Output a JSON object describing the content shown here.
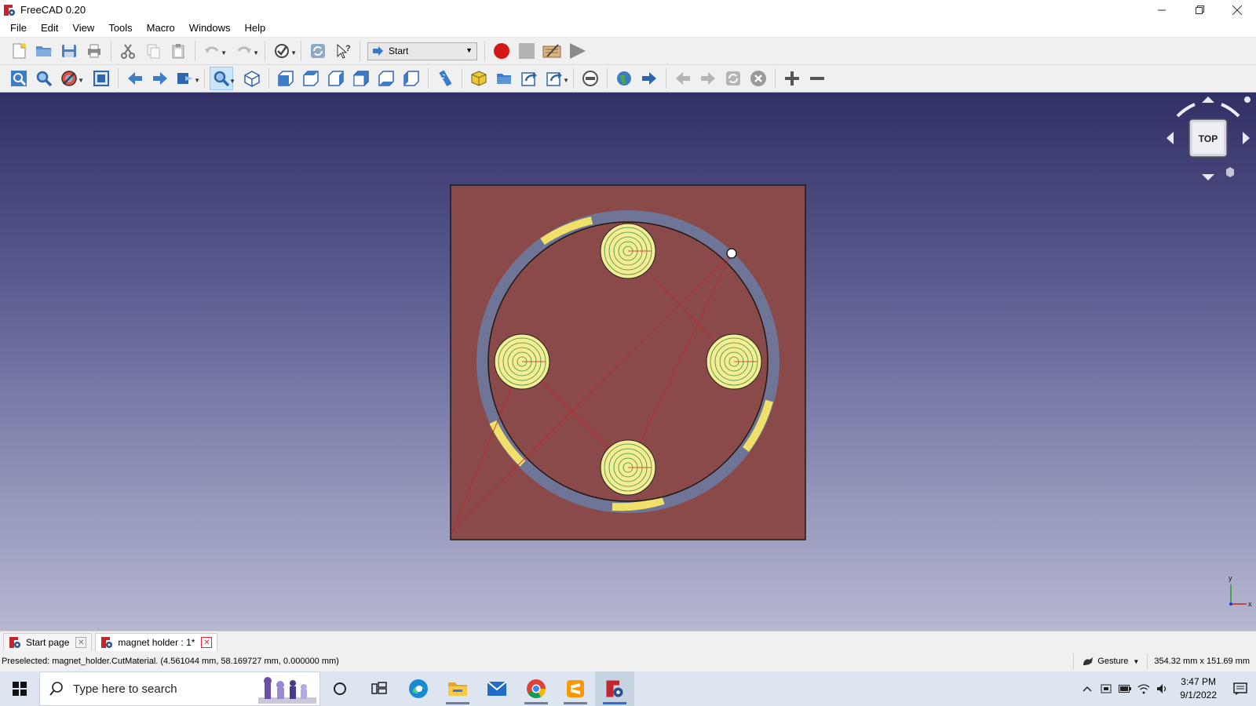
{
  "window": {
    "title": "FreeCAD 0.20"
  },
  "menu": [
    "File",
    "Edit",
    "View",
    "Tools",
    "Macro",
    "Windows",
    "Help"
  ],
  "toolbar1": {
    "workbench": "Start",
    "icons": [
      "new-file-icon",
      "open-folder-icon",
      "save-icon",
      "print-icon",
      "cut-icon",
      "copy-icon",
      "paste-icon",
      "undo-icon",
      "redo-icon",
      "refresh-icon",
      "whats-this-icon",
      "workbench-icon",
      "record-macro-icon",
      "stop-macro-icon",
      "edit-macro-icon",
      "run-macro-icon"
    ]
  },
  "toolbar2": {
    "icons": [
      "fit-all-icon",
      "fit-selection-icon",
      "draw-style-icon",
      "bounding-box-icon",
      "back-icon",
      "forward-icon",
      "sync-view-icon",
      "zoom-icon",
      "isometric-icon",
      "front-view-icon",
      "top-view-icon",
      "right-view-icon",
      "rear-view-icon",
      "bottom-view-icon",
      "left-view-icon",
      "measure-icon",
      "part-icon",
      "group-icon",
      "link-icon",
      "link-actions-icon",
      "web-stop-icon",
      "web-home-icon",
      "web-go-icon",
      "web-back-icon",
      "web-forward-icon",
      "web-refresh-icon",
      "web-stop-loading-icon",
      "zoom-in-icon",
      "zoom-out-icon"
    ]
  },
  "navcube": {
    "face_label": "TOP"
  },
  "axis": {
    "y_label": "y",
    "x_label": "x"
  },
  "tabs": [
    {
      "label": "Start page",
      "active": false
    },
    {
      "label": "magnet holder : 1*",
      "active": true
    }
  ],
  "status": {
    "message": "Preselected: magnet_holder.CutMaterial. (4.561044 mm, 58.169727 mm, 0.000000 mm)",
    "nav_style": "Gesture",
    "dimensions": "354.32 mm x 151.69 mm"
  },
  "taskbar": {
    "search_placeholder": "Type here to search",
    "time": "3:47 PM",
    "date": "9/1/2022"
  },
  "colors": {
    "plate": "#8b4a4a",
    "ring": "#6f7596",
    "highlight": "#f0e06a",
    "magnet_fill": "#f5ec96",
    "contour": "#3b8f3b",
    "bg_top": "#313065",
    "bg_bottom": "#b6b8d1"
  }
}
